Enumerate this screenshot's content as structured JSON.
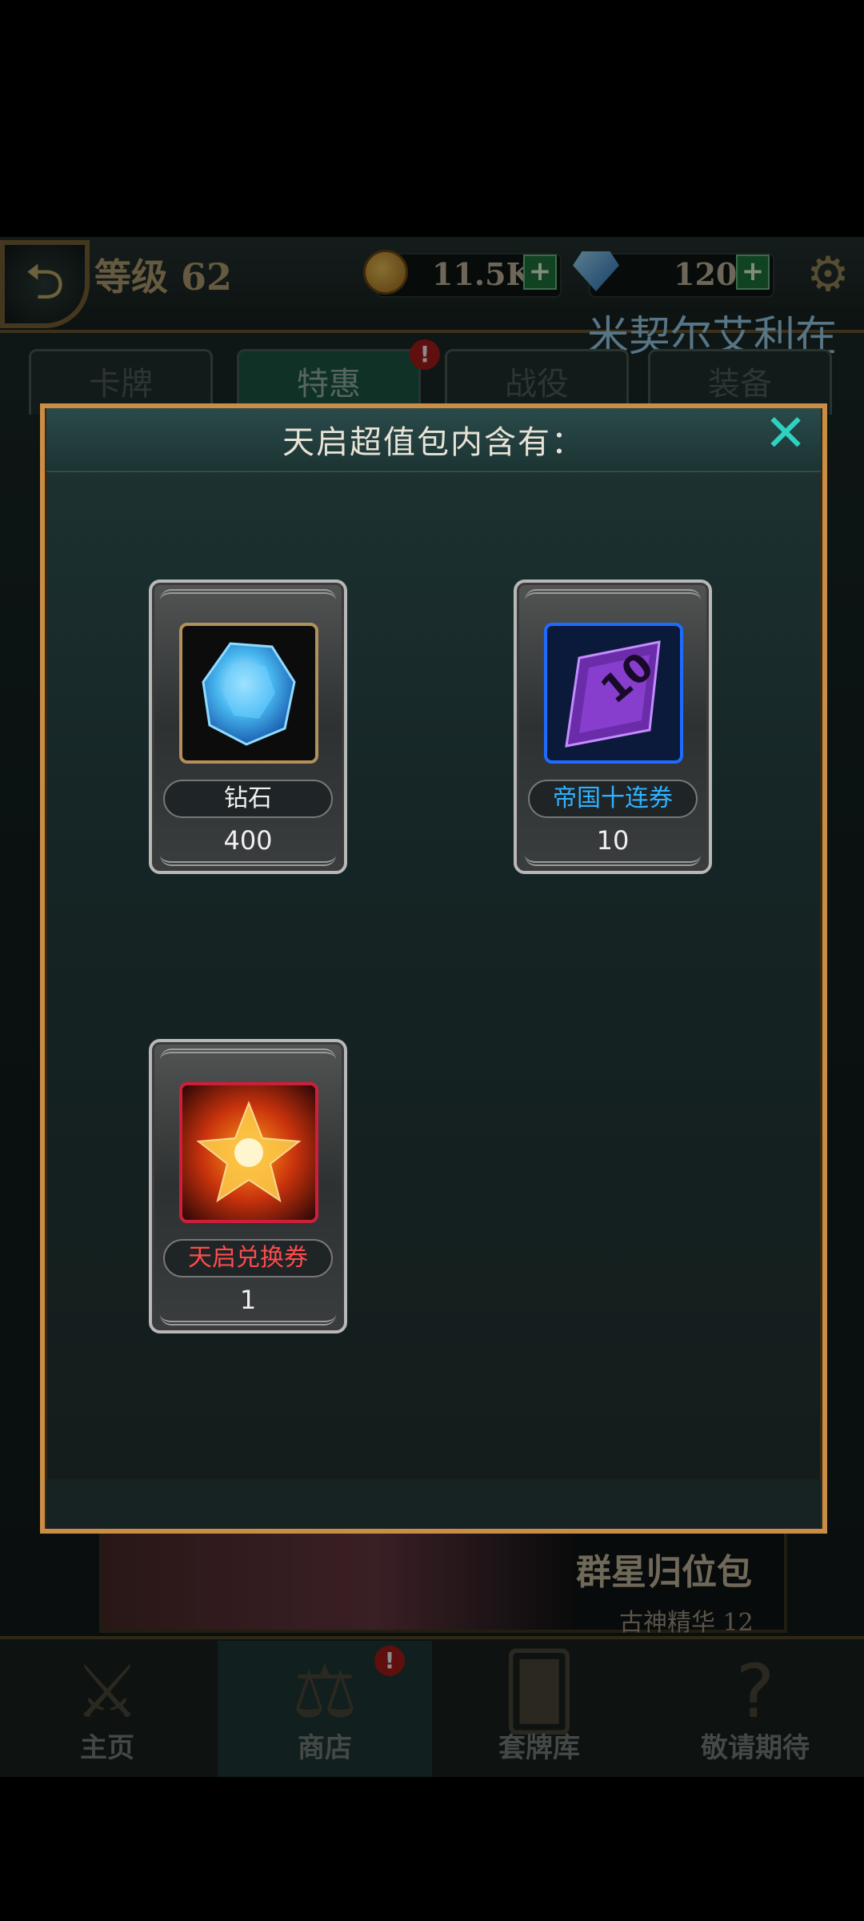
{
  "top_bar": {
    "back_glyph": "⮌",
    "level": "等级 62",
    "gold": "11.5K",
    "gems": "120",
    "plus": "+",
    "gear_glyph": "⚙",
    "marquee": "米契尔艾利在"
  },
  "tabs": [
    {
      "label": "卡牌"
    },
    {
      "label": "特惠"
    },
    {
      "label": "战役"
    },
    {
      "label": "装备"
    }
  ],
  "alert_mark": "!",
  "background_banner": {
    "title": "群星归位包",
    "subtitle": "古神精华 12"
  },
  "modal": {
    "title": "天启超值包内含有：",
    "close_glyph": "✕",
    "items": [
      {
        "name": "钻石",
        "count": "400",
        "name_color": "#f2f2f2",
        "icon": "diamond-icon"
      },
      {
        "name": "帝国十连券",
        "count": "10",
        "name_color": "#2fb2ff",
        "icon": "ten-draw-ticket-icon"
      },
      {
        "name": "天启兑换券",
        "count": "1",
        "name_color": "#ff4b4b",
        "icon": "apocalypse-star-icon"
      }
    ]
  },
  "bottom_nav": [
    {
      "label": "主页",
      "icon": "crossed-swords-icon",
      "glyph": "⚔"
    },
    {
      "label": "商店",
      "icon": "balance-scale-icon",
      "glyph": "⚖"
    },
    {
      "label": "套牌库",
      "icon": "card-deck-icon",
      "glyph": "🂠"
    },
    {
      "label": "敬请期待",
      "icon": "question-mark-icon",
      "glyph": "?"
    }
  ],
  "colors": {
    "modal_border": "#c98d46",
    "close_button": "#2fd1c2",
    "alert_red": "#b01d1d"
  }
}
